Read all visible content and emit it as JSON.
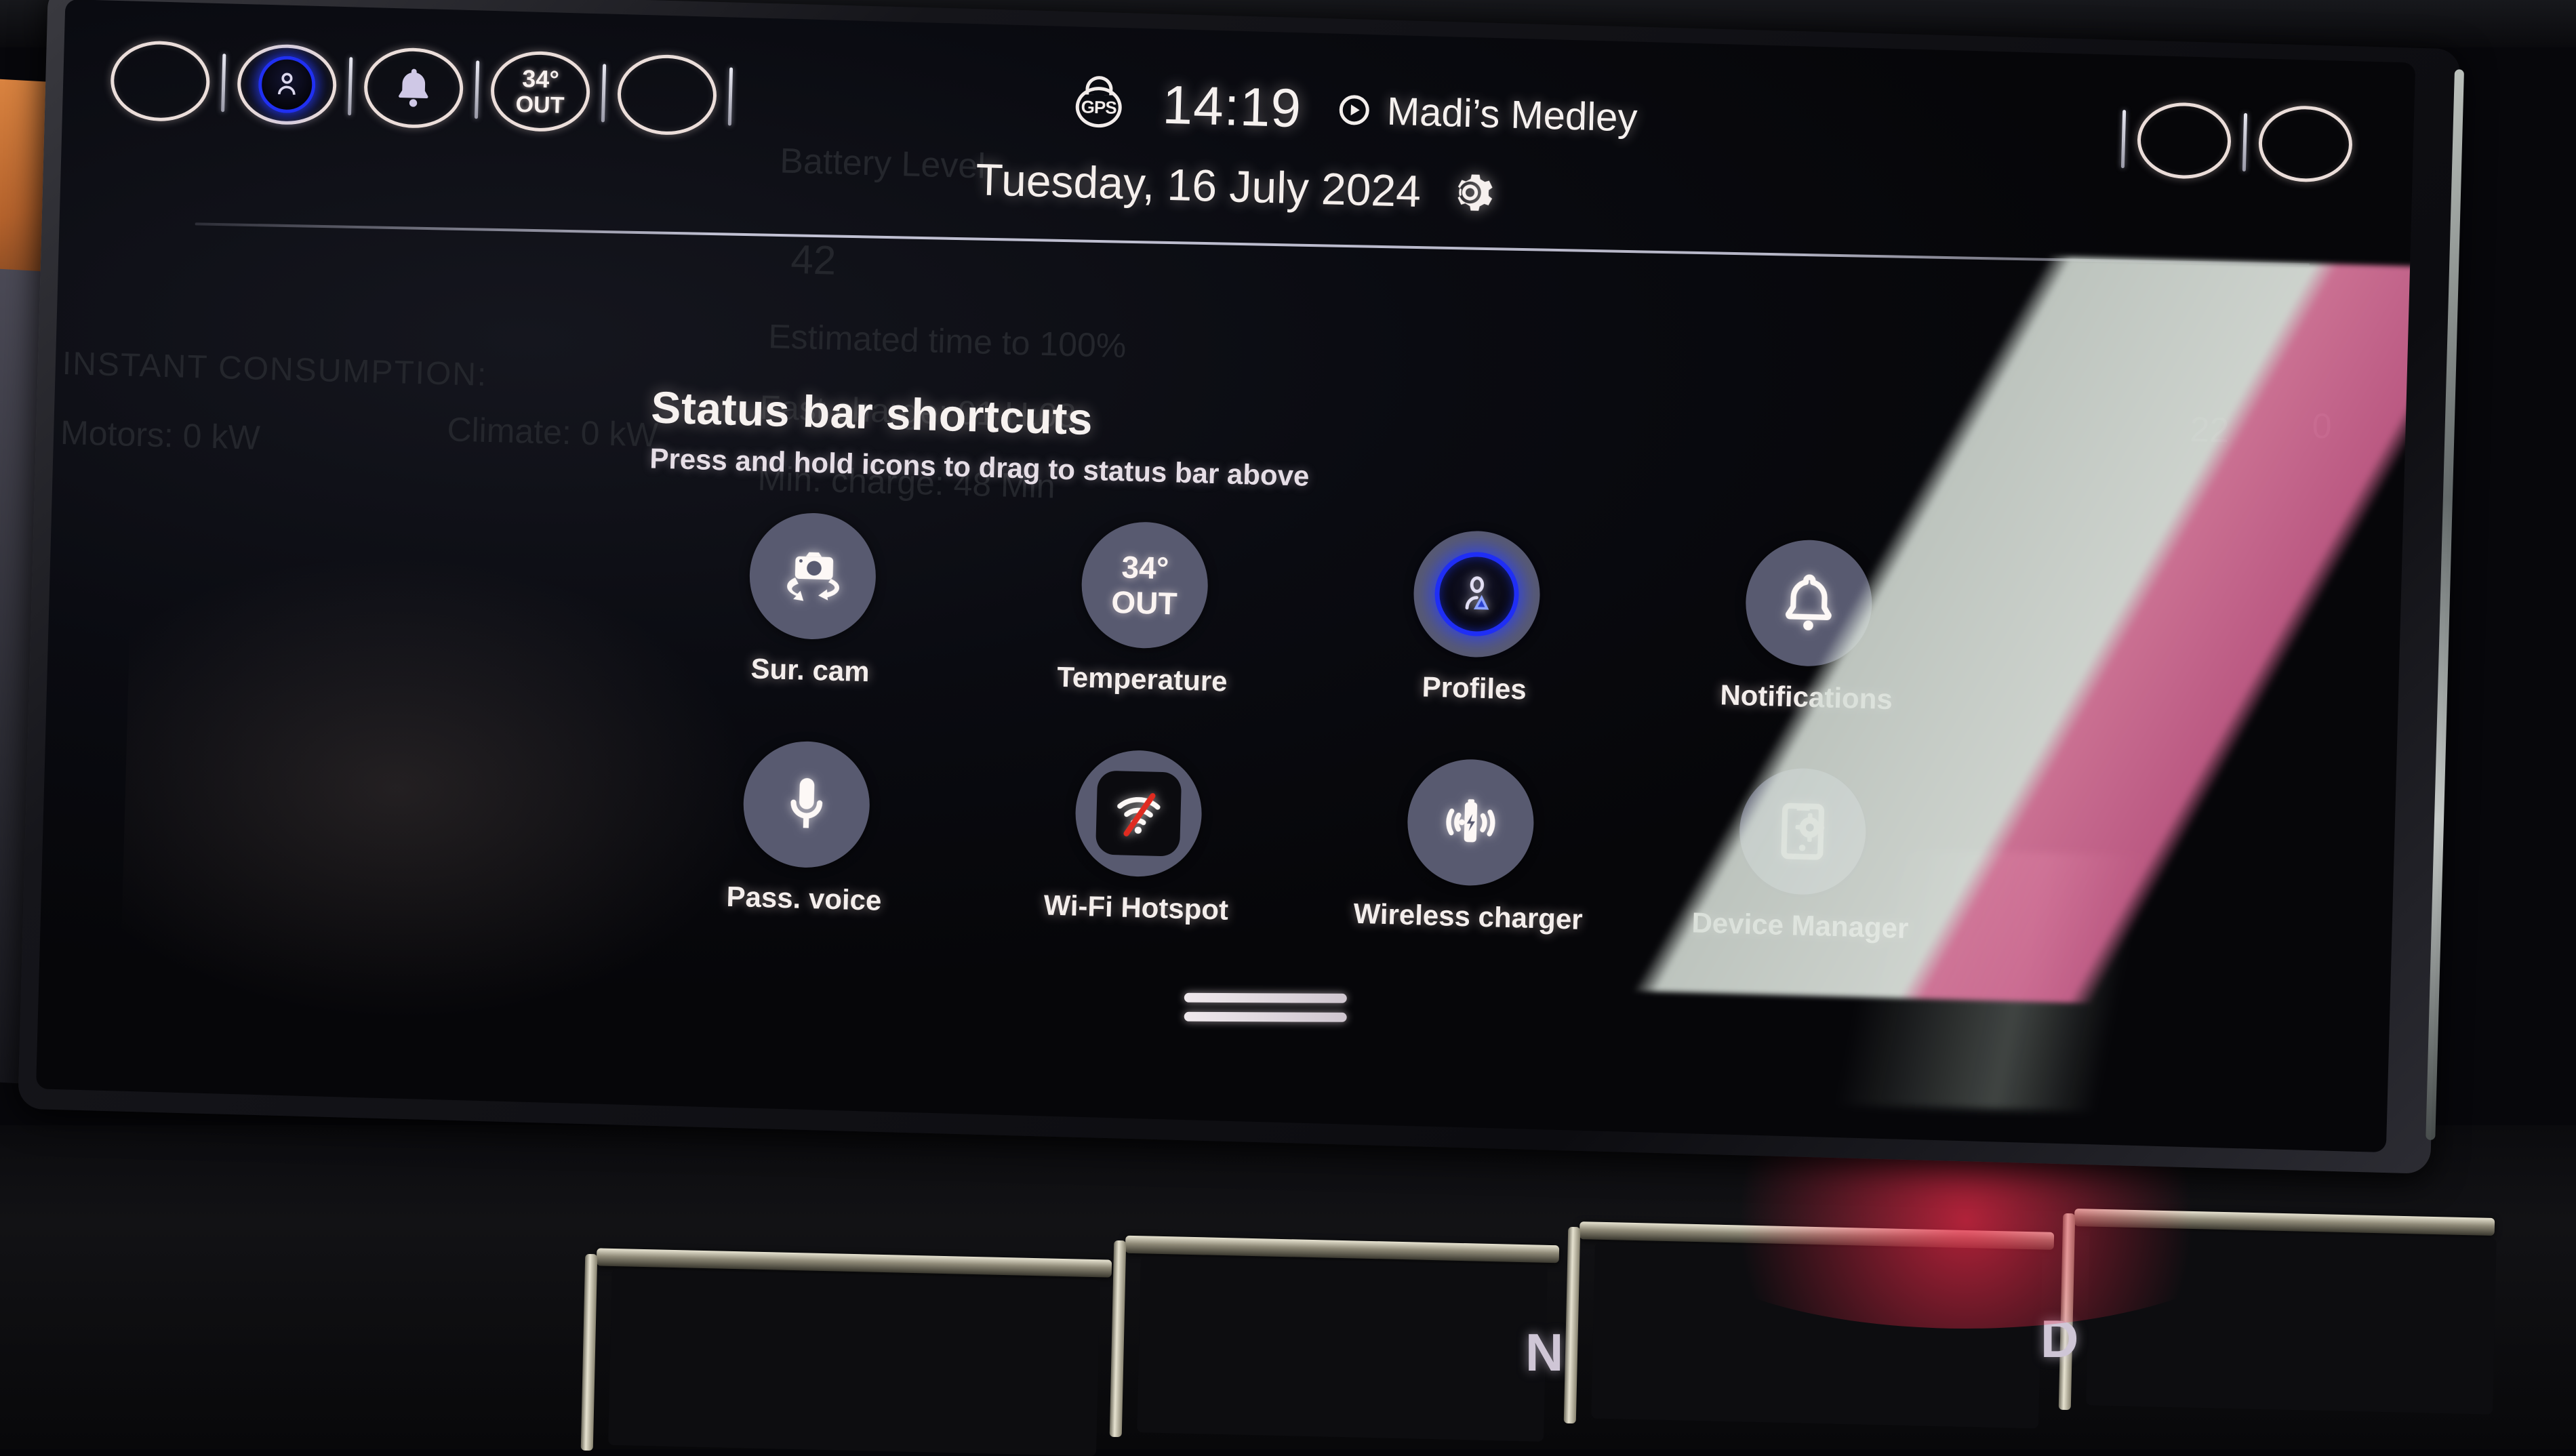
{
  "statusbar": {
    "left_slots": [
      {
        "name": "empty-slot-1",
        "type": "empty"
      },
      {
        "name": "profiles",
        "type": "profile",
        "label": "Profiles"
      },
      {
        "name": "notifications",
        "type": "bell",
        "label": "Notifications"
      },
      {
        "name": "temperature",
        "type": "temp",
        "line1": "34°",
        "line2": "OUT"
      },
      {
        "name": "empty-slot-2",
        "type": "empty"
      }
    ],
    "gps_label": "GPS",
    "time": "14:19",
    "media_title": "Madi’s Medley",
    "right_slots": [
      {
        "name": "empty-slot-3",
        "type": "empty"
      },
      {
        "name": "empty-slot-4",
        "type": "empty"
      }
    ]
  },
  "header": {
    "date": "Tuesday, 16 July 2024",
    "settings_icon": "gear-icon"
  },
  "panel": {
    "title": "Status bar shortcuts",
    "subtitle": "Press and hold icons to drag to status bar above",
    "shortcuts": [
      {
        "label": "Sur. cam",
        "icon": "surround-camera-icon",
        "style": "plain"
      },
      {
        "label": "Temperature",
        "icon": "temperature-icon",
        "style": "text",
        "line1": "34°",
        "line2": "OUT"
      },
      {
        "label": "Profiles",
        "icon": "profile-icon",
        "style": "profile"
      },
      {
        "label": "Notifications",
        "icon": "bell-icon",
        "style": "plain"
      },
      {
        "label": "Pass. voice",
        "icon": "microphone-icon",
        "style": "plain"
      },
      {
        "label": "Wi-Fi Hotspot",
        "icon": "wifi-off-icon",
        "style": "wifi"
      },
      {
        "label": "Wireless charger",
        "icon": "wireless-charging-icon",
        "style": "plain"
      },
      {
        "label": "Device Manager",
        "icon": "device-manager-icon",
        "style": "plain"
      }
    ]
  },
  "background_app": {
    "battery_level_label": "Battery Level",
    "battery_percent": "42",
    "estimated_label": "Estimated time to 100%",
    "fast_charge": "Fast charge:  01 H:03",
    "min_charge": "Min. charge:  48 Min",
    "instant_consumption_label": "INSTANT CONSUMPTION:",
    "motors": "Motors:  0 kW",
    "climate": "Climate:  0 kW",
    "range_left": "22",
    "range_right": "0"
  },
  "console": {
    "gear_n": "N",
    "gear_d": "D"
  },
  "colors": {
    "bubble": "#585a70",
    "profile_ring": "#1f2ef5",
    "screen_bg": "#0a0b11",
    "text": "#f5efec",
    "wifi_slash": "#e02b20"
  }
}
